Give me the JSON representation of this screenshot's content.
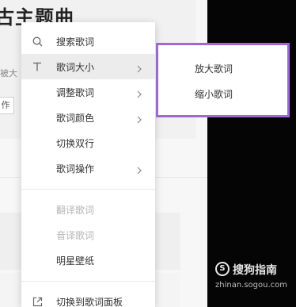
{
  "background": {
    "title_partial": "古主题曲",
    "text_partial": "被大",
    "button_partial": "作"
  },
  "menu": {
    "items": [
      {
        "label": "搜索歌词",
        "icon": "search-icon",
        "has_submenu": false,
        "disabled": false
      },
      {
        "label": "歌词大小",
        "icon": "text-size-icon",
        "has_submenu": true,
        "disabled": false,
        "highlighted": true
      },
      {
        "label": "调整歌词",
        "icon": "",
        "has_submenu": true,
        "disabled": false
      },
      {
        "label": "歌词颜色",
        "icon": "",
        "has_submenu": true,
        "disabled": false
      },
      {
        "label": "切换双行",
        "icon": "",
        "has_submenu": false,
        "disabled": false
      },
      {
        "label": "歌词操作",
        "icon": "",
        "has_submenu": true,
        "disabled": false
      },
      {
        "label": "翻译歌词",
        "icon": "",
        "has_submenu": false,
        "disabled": true
      },
      {
        "label": "音译歌词",
        "icon": "",
        "has_submenu": false,
        "disabled": true
      },
      {
        "label": "明星壁纸",
        "icon": "",
        "has_submenu": false,
        "disabled": false
      },
      {
        "label": "切换到歌词面板",
        "icon": "external-link-icon",
        "has_submenu": false,
        "disabled": false
      }
    ]
  },
  "submenu": {
    "items": [
      {
        "label": "放大歌词"
      },
      {
        "label": "缩小歌词"
      }
    ],
    "highlight_color": "#9b6ad6"
  },
  "watermark": {
    "logo_glyph": "S",
    "title": "搜狗指南",
    "url": "zhinan.sogou.com"
  }
}
